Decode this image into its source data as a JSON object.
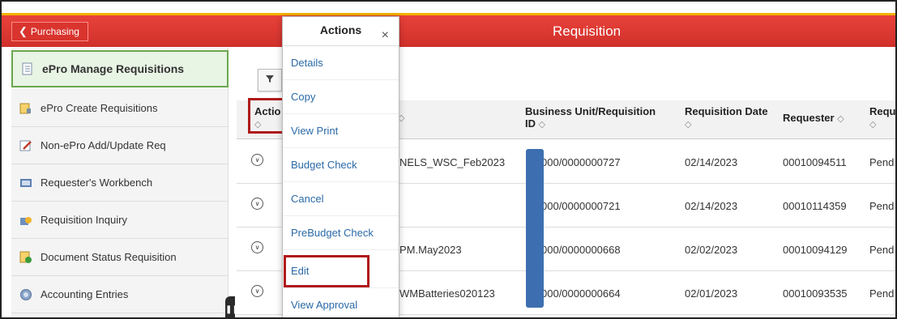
{
  "header": {
    "back_label": "Purchasing",
    "title": "Requisition"
  },
  "sidebar": {
    "items": [
      {
        "label": "ePro Manage Requisitions",
        "icon": "list-doc-icon"
      },
      {
        "label": "ePro Create Requisitions",
        "icon": "doc-pencil-icon"
      },
      {
        "label": "Non-ePro Add/Update Req",
        "icon": "edit-icon"
      },
      {
        "label": "Requester's Workbench",
        "icon": "workbench-icon"
      },
      {
        "label": "Requisition Inquiry",
        "icon": "inquiry-icon"
      },
      {
        "label": "Document Status Requisition",
        "icon": "doc-check-icon"
      },
      {
        "label": "Accounting Entries",
        "icon": "accounting-icon"
      }
    ]
  },
  "popup": {
    "title": "Actions",
    "close": "×",
    "items": [
      "Details",
      "Copy",
      "View Print",
      "Budget Check",
      "Cancel",
      "PreBudget Check",
      "Edit",
      "View Approval"
    ]
  },
  "grid": {
    "headers": {
      "actions": "Actio",
      "bu_req_line1": "Business Unit/Requisition",
      "bu_req_line2": "ID",
      "req_date": "Requisition Date",
      "requester": "Requester",
      "status": "Requ"
    },
    "sort_icon": "◇",
    "rows": [
      {
        "name": "NELS_WSC_Feb2023",
        "bu_req": "000/0000000727",
        "date": "02/14/2023",
        "requester": "00010094511",
        "status": "Pend"
      },
      {
        "name": "",
        "bu_req": "000/0000000721",
        "date": "02/14/2023",
        "requester": "00010114359",
        "status": "Pend"
      },
      {
        "name": "PM.May2023",
        "bu_req": "000/0000000668",
        "date": "02/02/2023",
        "requester": "00010094129",
        "status": "Pend"
      },
      {
        "name": "WMBatteries020123",
        "bu_req": "000/0000000664",
        "date": "02/01/2023",
        "requester": "00010093535",
        "status": "Pend"
      }
    ]
  },
  "colors": {
    "header_red": "#d0302b",
    "link_blue": "#2a69a6",
    "highlight_red": "#b01a1a",
    "active_green": "#6aa84f"
  }
}
